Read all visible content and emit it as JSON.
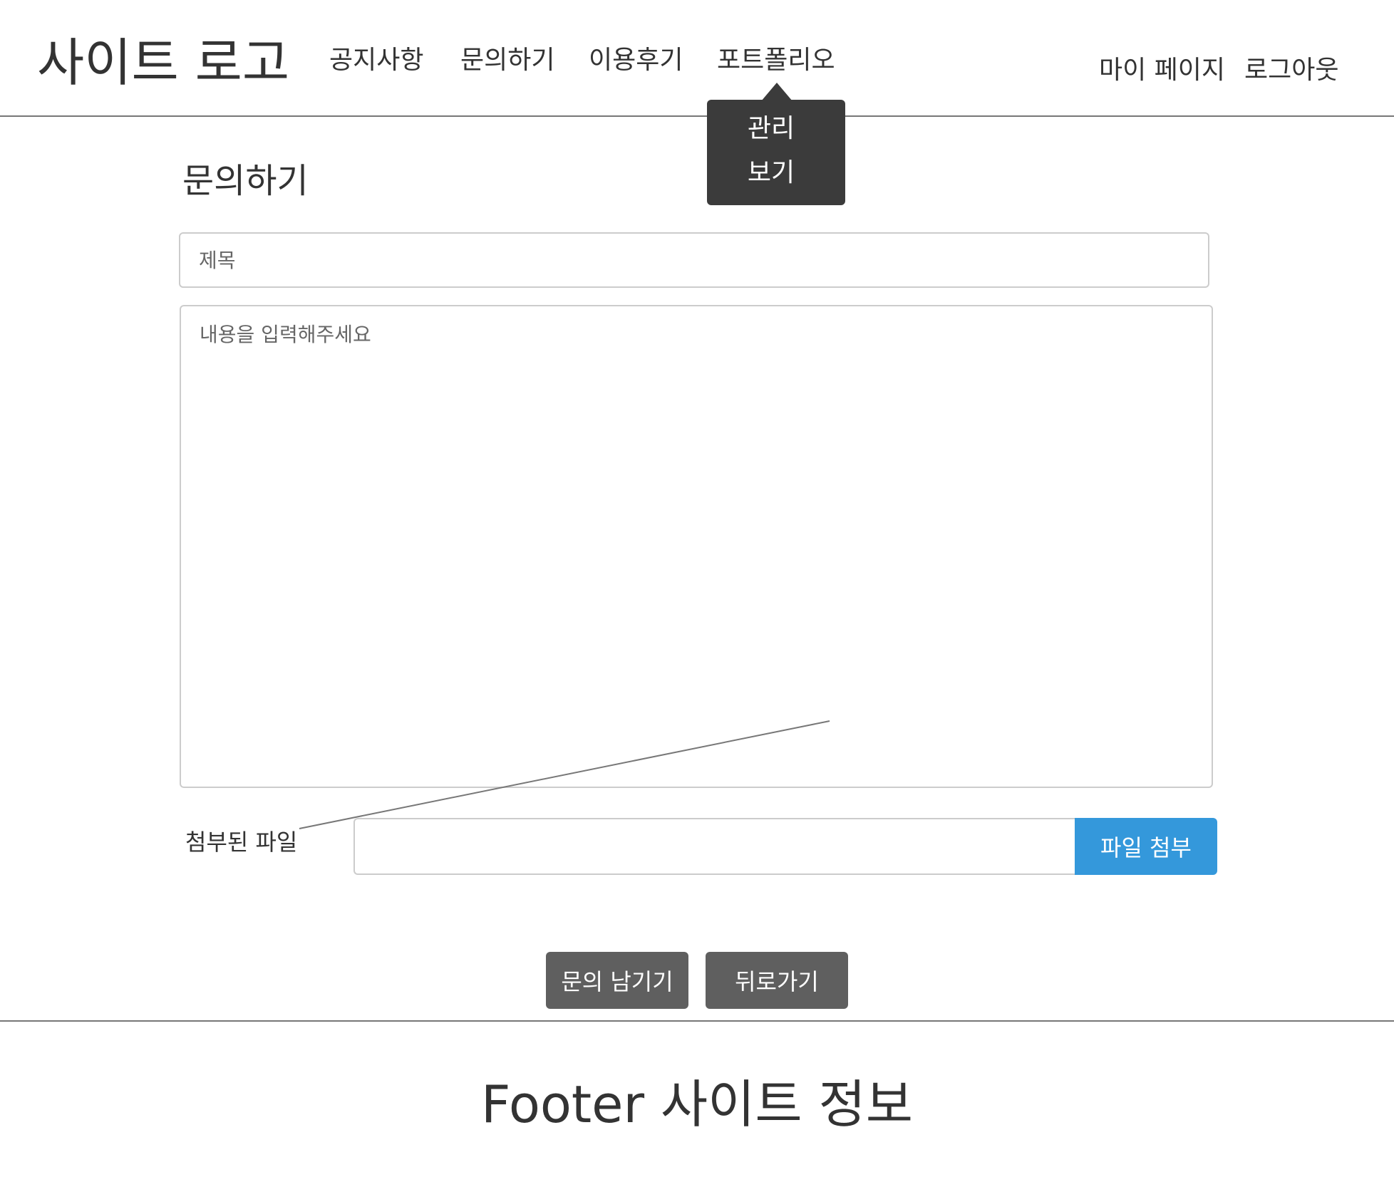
{
  "header": {
    "logo": "사이트 로고",
    "nav": [
      {
        "label": "공지사항"
      },
      {
        "label": "문의하기"
      },
      {
        "label": "이용후기"
      },
      {
        "label": "포트폴리오"
      }
    ],
    "right_nav": [
      {
        "label": "마이 페이지"
      },
      {
        "label": "로그아웃"
      }
    ],
    "dropdown": {
      "items": [
        {
          "label": "관리"
        },
        {
          "label": "보기"
        }
      ]
    }
  },
  "main": {
    "title": "문의하기",
    "subject_placeholder": "제목",
    "content_placeholder": "내용을 입력해주세요",
    "attachment": {
      "label": "첨부된 파일",
      "value": "",
      "button_label": "파일 첨부"
    },
    "actions": {
      "submit_label": "문의 남기기",
      "back_label": "뒤로가기"
    }
  },
  "footer": {
    "text": "Footer 사이트 정보"
  },
  "colors": {
    "primary": "#3498db",
    "secondary_button": "#5f5f5f",
    "dropdown_bg": "#3b3b3b",
    "text": "#333333",
    "border": "#cccccc"
  }
}
